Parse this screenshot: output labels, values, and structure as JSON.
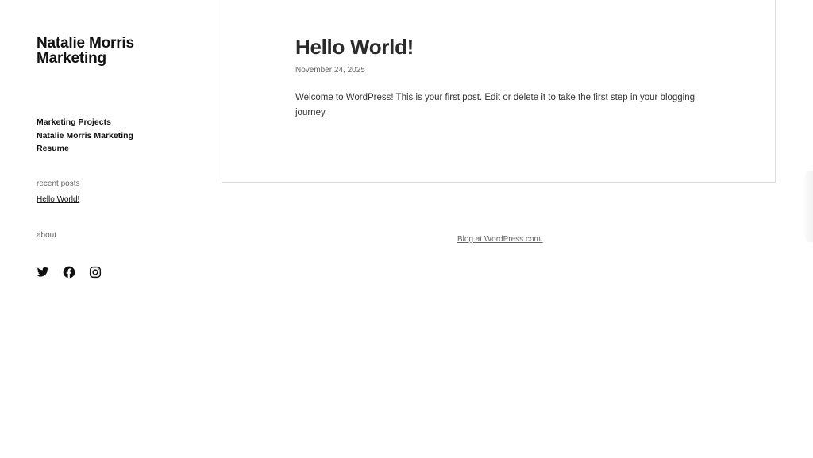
{
  "site": {
    "title": "Natalie Morris Marketing"
  },
  "nav": {
    "items": [
      {
        "label": "Marketing Projects"
      },
      {
        "label": "Natalie Morris Marketing"
      },
      {
        "label": "Resume"
      }
    ]
  },
  "widgets": {
    "recent_heading": "recent posts",
    "recent_link": "Hello World!",
    "about_heading": "about"
  },
  "social": {
    "icons": [
      "twitter-icon",
      "facebook-icon",
      "instagram-icon"
    ]
  },
  "post": {
    "title": "Hello World!",
    "date": "November 24, 2025",
    "body": "Welcome to WordPress! This is your first post. Edit or delete it to take the first step in your blogging journey."
  },
  "footer": {
    "credit": "Blog at WordPress.com."
  },
  "colors": {
    "text": "#111111",
    "muted": "#666666",
    "border": "#dcdcdc"
  }
}
